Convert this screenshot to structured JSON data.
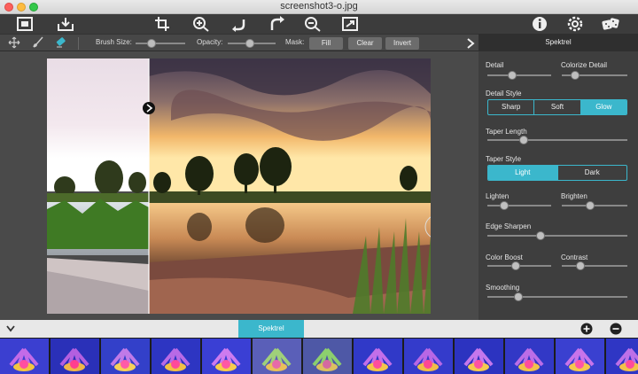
{
  "window": {
    "title": "screenshot3-o.jpg"
  },
  "options": {
    "brush_size_label": "Brush Size:",
    "opacity_label": "Opacity:",
    "mask_label": "Mask:",
    "fill_label": "Fill",
    "clear_label": "Clear",
    "invert_label": "Invert"
  },
  "panel": {
    "title": "Spektrel",
    "detail": "Detail",
    "colorize_detail": "Colorize Detail",
    "detail_style": "Detail Style",
    "detail_style_options": [
      "Sharp",
      "Soft",
      "Glow"
    ],
    "taper_length": "Taper Length",
    "taper_style": "Taper Style",
    "taper_style_options": [
      "Light",
      "Dark"
    ],
    "lighten": "Lighten",
    "brighten": "Brighten",
    "edge_sharpen": "Edge Sharpen",
    "color_boost": "Color Boost",
    "contrast": "Contrast",
    "smoothing": "Smoothing"
  },
  "bottom": {
    "preset_tab": "Spektrel"
  },
  "colors": {
    "accent": "#3bb7cc"
  }
}
